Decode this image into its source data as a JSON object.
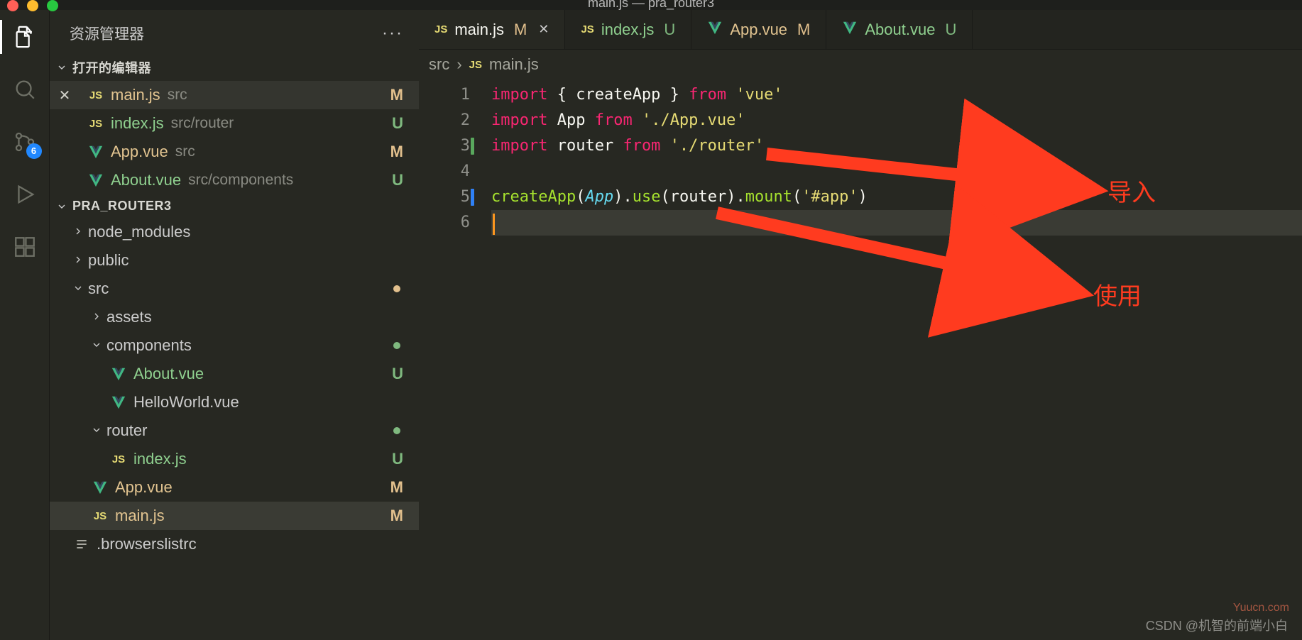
{
  "titlebar": {
    "title": "main.js — pra_router3"
  },
  "activityBar": {
    "items": [
      {
        "name": "explorer",
        "active": true
      },
      {
        "name": "search",
        "active": false
      },
      {
        "name": "scm",
        "active": false,
        "badge": "6"
      },
      {
        "name": "run-debug",
        "active": false
      },
      {
        "name": "extensions",
        "active": false
      }
    ]
  },
  "sidebar": {
    "title": "资源管理器",
    "openEditors": {
      "header": "打开的编辑器",
      "items": [
        {
          "icon": "js",
          "name": "main.js",
          "path": "src",
          "status": "M",
          "active": true
        },
        {
          "icon": "js",
          "name": "index.js",
          "path": "src/router",
          "status": "U"
        },
        {
          "icon": "vue",
          "name": "App.vue",
          "path": "src",
          "status": "M"
        },
        {
          "icon": "vue",
          "name": "About.vue",
          "path": "src/components",
          "status": "U"
        }
      ]
    },
    "project": {
      "header": "PRA_ROUTER3",
      "tree": [
        {
          "depth": 1,
          "kind": "folder",
          "chev": "right",
          "name": "node_modules"
        },
        {
          "depth": 1,
          "kind": "folder",
          "chev": "right",
          "name": "public"
        },
        {
          "depth": 1,
          "kind": "folder",
          "chev": "down",
          "name": "src",
          "dot": "modified"
        },
        {
          "depth": 2,
          "kind": "folder",
          "chev": "right",
          "name": "assets"
        },
        {
          "depth": 2,
          "kind": "folder",
          "chev": "down",
          "name": "components",
          "dot": "untracked"
        },
        {
          "depth": 3,
          "kind": "file",
          "icon": "vue",
          "name": "About.vue",
          "status": "U"
        },
        {
          "depth": 3,
          "kind": "file",
          "icon": "vue",
          "name": "HelloWorld.vue"
        },
        {
          "depth": 2,
          "kind": "folder",
          "chev": "down",
          "name": "router",
          "dot": "untracked"
        },
        {
          "depth": 3,
          "kind": "file",
          "icon": "js",
          "name": "index.js",
          "status": "U"
        },
        {
          "depth": 2,
          "kind": "file",
          "icon": "vue",
          "name": "App.vue",
          "status": "M"
        },
        {
          "depth": 2,
          "kind": "file",
          "icon": "js",
          "name": "main.js",
          "status": "M",
          "selected": true
        },
        {
          "depth": 1,
          "kind": "file",
          "icon": "lines",
          "name": ".browserslistrc"
        }
      ]
    }
  },
  "tabs": [
    {
      "icon": "js",
      "name": "main.js",
      "status": "M",
      "active": true,
      "close": true
    },
    {
      "icon": "js",
      "name": "index.js",
      "status": "U"
    },
    {
      "icon": "vue",
      "name": "App.vue",
      "status": "M"
    },
    {
      "icon": "vue",
      "name": "About.vue",
      "status": "U"
    }
  ],
  "breadcrumb": {
    "segments": [
      "src",
      "main.js"
    ],
    "lastIcon": "js"
  },
  "editor": {
    "lineNumbers": [
      "1",
      "2",
      "3",
      "4",
      "5",
      "6"
    ],
    "gutterMarks": {
      "3": "green",
      "5": "blue"
    },
    "currentLine": 6,
    "lines": [
      [
        {
          "t": "import ",
          "c": "kw"
        },
        {
          "t": "{ ",
          "c": "punc"
        },
        {
          "t": "createApp",
          "c": "id"
        },
        {
          "t": " } ",
          "c": "punc"
        },
        {
          "t": "from ",
          "c": "kw"
        },
        {
          "t": "'vue'",
          "c": "str"
        }
      ],
      [
        {
          "t": "import ",
          "c": "kw"
        },
        {
          "t": "App",
          "c": "id"
        },
        {
          "t": " from ",
          "c": "kw"
        },
        {
          "t": "'./App.vue'",
          "c": "str"
        }
      ],
      [
        {
          "t": "import ",
          "c": "kw"
        },
        {
          "t": "router",
          "c": "id"
        },
        {
          "t": " from ",
          "c": "kw"
        },
        {
          "t": "'./router'",
          "c": "str"
        }
      ],
      [],
      [
        {
          "t": "createApp",
          "c": "fn"
        },
        {
          "t": "(",
          "c": "punc"
        },
        {
          "t": "App",
          "c": "cls"
        },
        {
          "t": ").",
          "c": "punc"
        },
        {
          "t": "use",
          "c": "fn"
        },
        {
          "t": "(",
          "c": "punc"
        },
        {
          "t": "router",
          "c": "id"
        },
        {
          "t": ").",
          "c": "punc"
        },
        {
          "t": "mount",
          "c": "fn"
        },
        {
          "t": "(",
          "c": "punc"
        },
        {
          "t": "'#app'",
          "c": "str"
        },
        {
          "t": ")",
          "c": "punc"
        }
      ],
      []
    ]
  },
  "annotations": {
    "label_import": "导入",
    "label_use": "使用"
  },
  "footer": {
    "credit": "CSDN @机智的前端小白",
    "watermark": "Yuucn.com"
  }
}
